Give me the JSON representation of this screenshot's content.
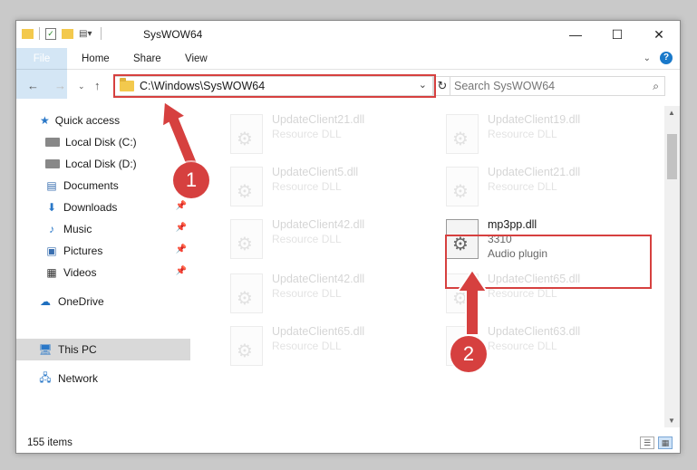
{
  "window": {
    "title": "SysWOW64",
    "controls": {
      "minimize": "—",
      "maximize": "☐",
      "close": "✕"
    }
  },
  "ribbon": {
    "tabs": {
      "file": "File",
      "home": "Home",
      "share": "Share",
      "view": "View"
    },
    "help": "?"
  },
  "navigation": {
    "address_path": "C:\\Windows\\SysWOW64",
    "search_placeholder": "Search SysWOW64"
  },
  "sidebar": {
    "quick_access": "Quick access",
    "local_disk_c": "Local Disk (C:)",
    "local_disk_d": "Local Disk (D:)",
    "documents": "Documents",
    "downloads": "Downloads",
    "music": "Music",
    "pictures": "Pictures",
    "videos": "Videos",
    "onedrive": "OneDrive",
    "this_pc": "This PC",
    "network": "Network"
  },
  "files": {
    "f1": {
      "name": "UpdateClient21.dll",
      "type": "Resource DLL"
    },
    "f2": {
      "name": "UpdateClient19.dll",
      "type": "Resource DLL"
    },
    "f3": {
      "name": "UpdateClient5.dll",
      "type": "Resource DLL"
    },
    "f4": {
      "name": "UpdateClient21.dll",
      "type": "Resource DLL"
    },
    "f5": {
      "name": "UpdateClient42.dll",
      "type": "Resource DLL"
    },
    "f6": {
      "name": "UpdateClient42.dll",
      "type": "Resource DLL"
    },
    "f7": {
      "name": "UpdateClient65.dll",
      "type": "Resource DLL"
    },
    "f8": {
      "name": "UpdateClient65.dll",
      "type": "Resource DLL"
    },
    "f9": {
      "name": "UpdateClient65.dll",
      "type": "Resource DLL"
    },
    "f10": {
      "name": "UpdateClient63.dll",
      "type": "Resource DLL"
    },
    "target": {
      "name": "mp3pp.dll",
      "size": "3310",
      "type": "Audio plugin"
    }
  },
  "status": {
    "item_count": "155 items"
  },
  "annotations": {
    "step1": "1",
    "step2": "2",
    "color": "#d6403f"
  }
}
